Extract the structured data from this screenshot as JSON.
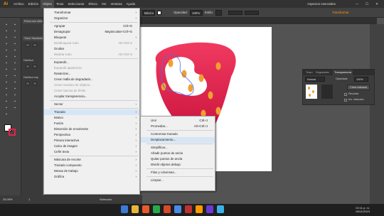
{
  "app": {
    "logo": "Ai"
  },
  "menubar": {
    "items": [
      "Archivo",
      "Edición",
      "Objeto",
      "Texto",
      "Seleccionar",
      "Efecto",
      "Ver",
      "Ventana",
      "Ayuda"
    ],
    "workspace": "Aspectos esenciales",
    "minimize": "—",
    "maximize": "☐",
    "close": "✕"
  },
  "control": {
    "style_label": "Básico",
    "opacity_label": "Opacidad:",
    "opacity_value": "100%",
    "style2_label": "Estilo:",
    "shape_label": "Forma:",
    "transform_label": "Transformar"
  },
  "toolbar": {
    "icons": [
      "selection-tool",
      "direct-selection-tool",
      "magic-wand-tool",
      "lasso-tool",
      "pen-tool",
      "curvature-tool",
      "type-tool",
      "line-tool",
      "rectangle-tool",
      "paintbrush-tool",
      "shaper-tool",
      "pencil-tool",
      "eraser-tool",
      "rotate-tool",
      "scale-tool",
      "width-tool",
      "free-transform-tool",
      "shape-builder-tool",
      "perspective-tool",
      "mesh-tool",
      "gradient-tool",
      "eyedropper-tool",
      "blend-tool",
      "symbol-sprayer-tool",
      "column-graph-tool",
      "artboard-tool",
      "slice-tool",
      "hand-tool",
      "zoom-tool"
    ]
  },
  "leftpanel": {
    "panel1_tab": "Trazo Transformar",
    "panel2_tab": "Distribuir",
    "panel3_tab": "Distribuir esp",
    "doc_tab": "Prima com último"
  },
  "document_tab": "Prima con último",
  "object_menu": {
    "items": [
      {
        "label": "Transformar",
        "arrow": true
      },
      {
        "label": "Organizar",
        "arrow": true
      },
      {
        "sep": true
      },
      {
        "label": "Agrupar",
        "shortcut": "Ctrl+G"
      },
      {
        "label": "Desagrupar",
        "shortcut": "Mayúsculas+Ctrl+G"
      },
      {
        "label": "Bloquear",
        "arrow": true
      },
      {
        "label": "Desbloquear todo",
        "shortcut": "Alt+Ctrl+2",
        "disabled": true
      },
      {
        "label": "Ocultar",
        "arrow": true
      },
      {
        "label": "Mostrar todo",
        "shortcut": "Alt+Ctrl+3",
        "disabled": true
      },
      {
        "sep": true
      },
      {
        "label": "Expandir..."
      },
      {
        "label": "Expandir apariencia",
        "disabled": true
      },
      {
        "label": "Rasterizar..."
      },
      {
        "label": "Crear malla de degradado..."
      },
      {
        "label": "Crear mosaico de objetos...",
        "disabled": true
      },
      {
        "label": "Crear marcas de límite",
        "disabled": true
      },
      {
        "label": "Acoplar transparencia..."
      },
      {
        "sep": true
      },
      {
        "label": "Sector",
        "arrow": true
      },
      {
        "sep": true
      },
      {
        "label": "Trazado",
        "arrow": true,
        "highlight": true
      },
      {
        "label": "Motivo",
        "arrow": true
      },
      {
        "label": "Fusión",
        "arrow": true
      },
      {
        "label": "Distorsión de envolvente",
        "arrow": true
      },
      {
        "label": "Perspectiva",
        "arrow": true
      },
      {
        "label": "Pintura interactiva",
        "arrow": true
      },
      {
        "label": "Calco de imagen",
        "arrow": true
      },
      {
        "label": "Ceñir texto",
        "arrow": true
      },
      {
        "sep": true
      },
      {
        "label": "Máscara de recorte",
        "arrow": true
      },
      {
        "label": "Trazado compuesto",
        "arrow": true
      },
      {
        "label": "Mesas de trabajo",
        "arrow": true
      },
      {
        "label": "Gráfica",
        "arrow": true
      }
    ]
  },
  "path_submenu": {
    "items": [
      {
        "label": "Unir",
        "shortcut": "Ctrl+J"
      },
      {
        "label": "Promediar...",
        "shortcut": "Alt+Ctrl+J"
      },
      {
        "sep": true
      },
      {
        "label": "Contornear trazado"
      },
      {
        "label": "Desplazamiento...",
        "highlight": true
      },
      {
        "sep": true
      },
      {
        "label": "Simplificar..."
      },
      {
        "label": "Añadir puntos de ancla"
      },
      {
        "label": "Quitar puntos de ancla"
      },
      {
        "label": "Dividir objetos debajo"
      },
      {
        "sep": true
      },
      {
        "label": "Filas y columnas..."
      },
      {
        "sep": true
      },
      {
        "label": "Limpiar..."
      }
    ]
  },
  "transparency_panel": {
    "tabs": [
      "Trazo",
      "Degradado",
      "Transparencia"
    ],
    "active_tab": "Transparencia",
    "mode": "Normal",
    "opacity_label": "Opacidad:",
    "opacity_value": "100%",
    "make_mask": "Crear máscara",
    "clip": "Recortar",
    "invert": "Inv. máscara"
  },
  "status": {
    "zoom": "25.09%",
    "tool": "Selección",
    "artboard": "1"
  },
  "taskbar": {
    "time": "02:11 p. m.",
    "date": "08/11/2023"
  },
  "colors": {
    "accent": "#ff9a00",
    "highlight": "#d6e6f6",
    "strawberry": "#e8204a",
    "seed": "#f0a030"
  }
}
